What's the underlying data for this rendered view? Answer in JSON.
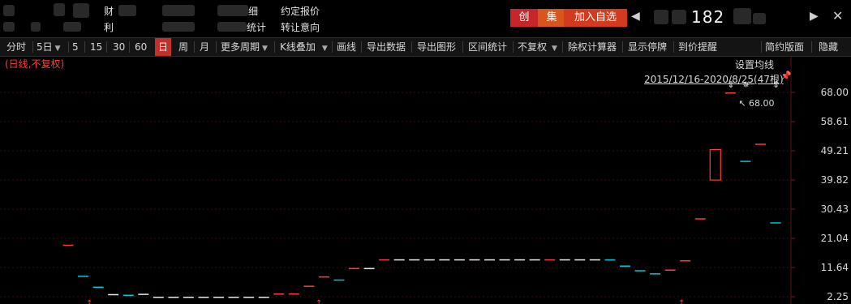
{
  "header": {
    "info": {
      "row1": [
        "财",
        "细",
        "约定报价"
      ],
      "row2": [
        "利",
        "统计",
        "转让意向"
      ]
    },
    "badges": {
      "chuang": "创",
      "ji": "集",
      "add_watch": "加入自选"
    },
    "nav": {
      "prev_icon": "triangle-left-icon",
      "next_icon": "triangle-right-icon"
    },
    "stock_code_visible": "182",
    "close_icon": "close-x-icon"
  },
  "toolbar": {
    "items": [
      {
        "label": "分时"
      },
      {
        "label": "5日"
      },
      {
        "label": "5"
      },
      {
        "label": "15"
      },
      {
        "label": "30"
      },
      {
        "label": "60"
      },
      {
        "label": "日"
      },
      {
        "label": "周"
      },
      {
        "label": "月"
      },
      {
        "label": "更多周期"
      },
      {
        "label": "K线叠加"
      },
      {
        "label": "画线"
      },
      {
        "label": "导出数据"
      },
      {
        "label": "导出图形"
      },
      {
        "label": "区间统计"
      },
      {
        "label": "不复权"
      },
      {
        "label": "除权计算器"
      },
      {
        "label": "显示停牌"
      },
      {
        "label": "到价提醒"
      },
      {
        "label": "简约版面"
      },
      {
        "label": "隐藏"
      }
    ],
    "active": "日"
  },
  "chart": {
    "mode_label": "(日线,不复权)",
    "settings_label": "设置均线",
    "range_label": "2015/12/16-2020/8/25(47根)",
    "high_marker": "68.00",
    "colors": {
      "up": "#ff3b3b",
      "down": "#00c8d2",
      "flat": "#e8e8e8",
      "bg": "#000000"
    }
  },
  "chart_data": {
    "type": "candlestick",
    "y_ticks": [
      "68.00",
      "58.61",
      "49.21",
      "39.82",
      "30.43",
      "21.04",
      "11.64",
      "2.25"
    ],
    "ylim": [
      2.25,
      68.0
    ],
    "max_label": "68.00",
    "candles": [
      {
        "open": 19.0,
        "close": 19.0,
        "color": "up"
      },
      {
        "open": 9.0,
        "close": 9.0,
        "color": "down"
      },
      {
        "open": 5.5,
        "close": 5.5,
        "color": "down"
      },
      {
        "open": 3.1,
        "close": 3.1,
        "color": "flat"
      },
      {
        "open": 2.9,
        "close": 2.9,
        "color": "down"
      },
      {
        "open": 3.2,
        "close": 3.2,
        "color": "flat"
      },
      {
        "open": 2.25,
        "close": 2.25,
        "color": "flat"
      },
      {
        "open": 2.25,
        "close": 2.25,
        "color": "flat"
      },
      {
        "open": 2.25,
        "close": 2.25,
        "color": "flat"
      },
      {
        "open": 2.25,
        "close": 2.25,
        "color": "flat"
      },
      {
        "open": 2.25,
        "close": 2.25,
        "color": "flat"
      },
      {
        "open": 2.25,
        "close": 2.25,
        "color": "flat"
      },
      {
        "open": 2.25,
        "close": 2.25,
        "color": "flat"
      },
      {
        "open": 2.25,
        "close": 2.25,
        "color": "flat"
      },
      {
        "open": 3.3,
        "close": 3.3,
        "color": "up"
      },
      {
        "open": 3.3,
        "close": 3.3,
        "color": "up"
      },
      {
        "open": 5.8,
        "close": 5.8,
        "color": "up"
      },
      {
        "open": 8.8,
        "close": 8.8,
        "color": "up"
      },
      {
        "open": 7.8,
        "close": 7.8,
        "color": "down"
      },
      {
        "open": 11.5,
        "close": 11.5,
        "color": "up"
      },
      {
        "open": 11.5,
        "close": 11.5,
        "color": "flat"
      },
      {
        "open": 14.3,
        "close": 14.3,
        "color": "up"
      },
      {
        "open": 14.3,
        "close": 14.3,
        "color": "flat"
      },
      {
        "open": 14.3,
        "close": 14.3,
        "color": "flat"
      },
      {
        "open": 14.3,
        "close": 14.3,
        "color": "flat"
      },
      {
        "open": 14.3,
        "close": 14.3,
        "color": "flat"
      },
      {
        "open": 14.3,
        "close": 14.3,
        "color": "flat"
      },
      {
        "open": 14.3,
        "close": 14.3,
        "color": "flat"
      },
      {
        "open": 14.3,
        "close": 14.3,
        "color": "flat"
      },
      {
        "open": 14.3,
        "close": 14.3,
        "color": "flat"
      },
      {
        "open": 14.3,
        "close": 14.3,
        "color": "flat"
      },
      {
        "open": 14.3,
        "close": 14.3,
        "color": "flat"
      },
      {
        "open": 14.3,
        "close": 14.3,
        "color": "up"
      },
      {
        "open": 14.3,
        "close": 14.3,
        "color": "flat"
      },
      {
        "open": 14.3,
        "close": 14.3,
        "color": "flat"
      },
      {
        "open": 14.3,
        "close": 14.3,
        "color": "flat"
      },
      {
        "open": 14.3,
        "close": 14.3,
        "color": "down"
      },
      {
        "open": 12.3,
        "close": 12.3,
        "color": "down"
      },
      {
        "open": 10.8,
        "close": 10.8,
        "color": "down"
      },
      {
        "open": 9.8,
        "close": 9.8,
        "color": "down"
      },
      {
        "open": 11.0,
        "close": 11.0,
        "color": "up"
      },
      {
        "open": 14.0,
        "close": 14.0,
        "color": "up"
      },
      {
        "open": 27.5,
        "close": 27.5,
        "color": "up"
      },
      {
        "open": 39.8,
        "close": 49.6,
        "color": "up"
      },
      {
        "open": 68.0,
        "close": 68.0,
        "color": "up"
      },
      {
        "open": 46.0,
        "close": 46.0,
        "color": "down"
      },
      {
        "open": 51.5,
        "close": 51.5,
        "color": "up"
      },
      {
        "open": 26.2,
        "close": 26.2,
        "color": "down"
      }
    ]
  }
}
